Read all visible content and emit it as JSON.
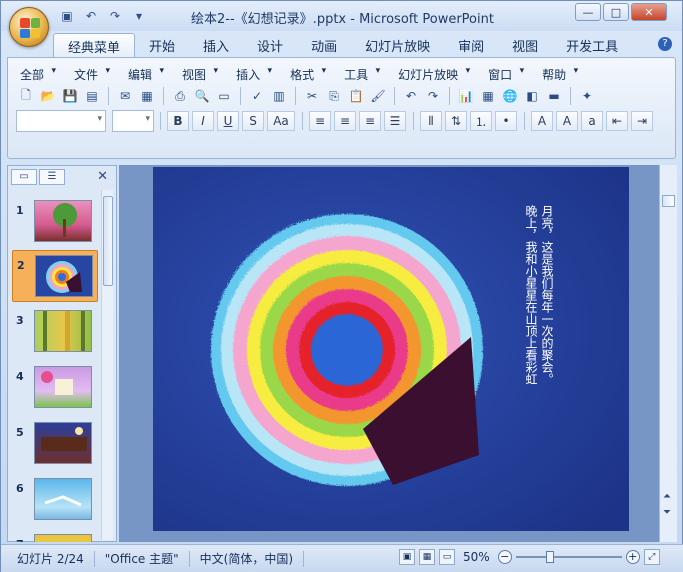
{
  "window": {
    "title": "绘本2--《幻想记录》.pptx - Microsoft PowerPoint",
    "min_label": "—",
    "max_label": "□",
    "close_label": "✕"
  },
  "tabs": [
    {
      "label": "经典菜单",
      "active": true
    },
    {
      "label": "开始"
    },
    {
      "label": "插入"
    },
    {
      "label": "设计"
    },
    {
      "label": "动画"
    },
    {
      "label": "幻灯片放映"
    },
    {
      "label": "审阅"
    },
    {
      "label": "视图"
    },
    {
      "label": "开发工具"
    }
  ],
  "menus": [
    "全部",
    "文件",
    "编辑",
    "视图",
    "插入",
    "格式",
    "工具",
    "幻灯片放映",
    "窗口",
    "帮助"
  ],
  "format_buttons": [
    "B",
    "I",
    "U",
    "S",
    "Aa"
  ],
  "slide_numbers": [
    "1",
    "2",
    "3",
    "4",
    "5",
    "6",
    "7"
  ],
  "selected_slide": 2,
  "slide_text": {
    "line1": "晚上，我和小星星在山顶上看彩虹",
    "line2": "月亮，这是我们每年一次的聚会。"
  },
  "status": {
    "slide_info": "幻灯片 2/24",
    "theme": "\"Office 主题\"",
    "language": "中文(简体，中国)",
    "zoom": "50%"
  },
  "colors": {
    "accent": "#f7b05a",
    "ribbon": "#dbe7f6",
    "slide_bg": "#2f4fa8"
  }
}
